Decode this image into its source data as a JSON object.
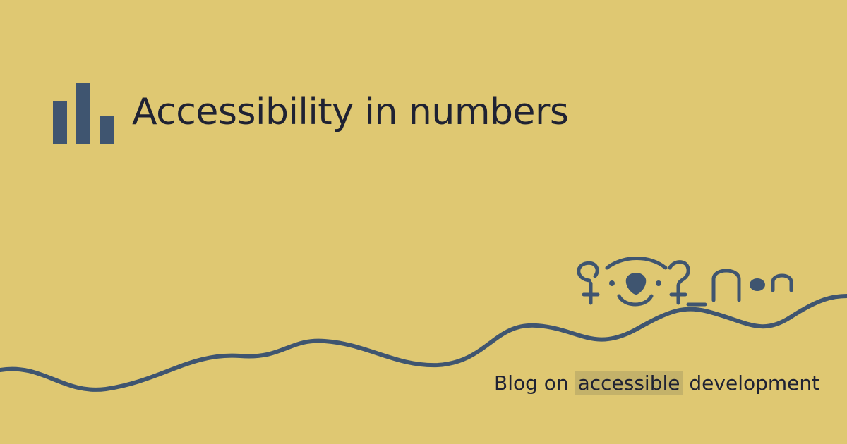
{
  "header": {
    "icon": "bar-chart-icon",
    "title": "Accessibility in numbers"
  },
  "tagline": {
    "before": "Blog on",
    "highlight": "accessible",
    "after": "development"
  },
  "logo": {
    "icon": "mascot-logo-icon"
  },
  "colors": {
    "background": "#dfc872",
    "accent": "#3f5570",
    "text": "#1f2233",
    "highlight": "#c4b26a"
  }
}
